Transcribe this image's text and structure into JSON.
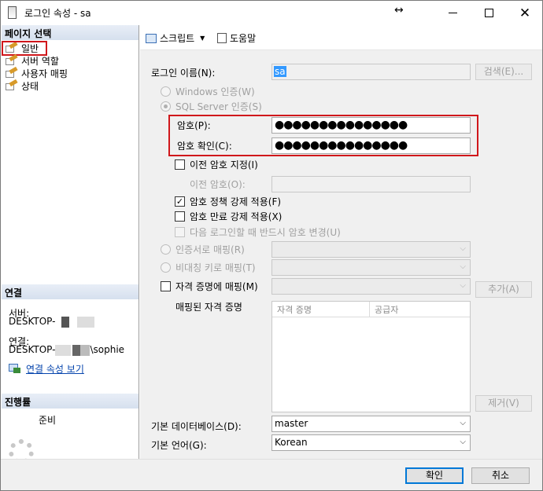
{
  "window": {
    "title": "로그인 속성 - sa"
  },
  "left": {
    "select_page_header": "페이지 선택",
    "pages": [
      {
        "label": "일반"
      },
      {
        "label": "서버 역할"
      },
      {
        "label": "사용자 매핑"
      },
      {
        "label": "상태"
      }
    ],
    "connection_header": "연결",
    "server_label": "서버:",
    "server_value": "DESKTOP-",
    "connection_label": "연결:",
    "connection_value": "DESKTOP-",
    "connection_suffix": "\\sophie",
    "view_connection_link": "연결 속성 보기",
    "progress_header": "진행률",
    "progress_status": "준비"
  },
  "toolbar": {
    "script_label": "스크립트",
    "help_label": "도움말"
  },
  "general": {
    "login_name_label": "로그인 이름(N):",
    "login_name_value": "sa",
    "search_button": "검색(E)...",
    "windows_auth_label": "Windows 인증(W)",
    "sql_auth_label": "SQL Server 인증(S)",
    "password_label": "암호(P):",
    "password_value": "●●●●●●●●●●●●●●●",
    "confirm_label": "암호 확인(C):",
    "confirm_value": "●●●●●●●●●●●●●●●",
    "specify_old_label": "이전 암호 지정(I)",
    "old_password_label": "이전 암호(O):",
    "enforce_policy_label": "암호 정책 강제 적용(F)",
    "enforce_expiration_label": "암호 만료 강제 적용(X)",
    "must_change_label": "다음 로그인할 때 반드시 암호 변경(U)",
    "cert_map_label": "인증서로 매핑(R)",
    "asym_key_label": "비대칭 키로 매핑(T)",
    "credential_label": "자격 증명에 매핑(M)",
    "add_button": "추가(A)",
    "mapped_credentials_label": "매핑된 자격 증명",
    "grid_columns": [
      "자격 증명",
      "공급자"
    ],
    "remove_button": "제거(V)",
    "default_db_label": "기본 데이터베이스(D):",
    "default_db_value": "master",
    "default_lang_label": "기본 언어(G):",
    "default_lang_value": "Korean"
  },
  "footer": {
    "ok_button": "확인",
    "cancel_button": "취소"
  },
  "colors": {
    "highlight": "#d0171b",
    "accent": "#0078d7",
    "link": "#0645ad"
  }
}
